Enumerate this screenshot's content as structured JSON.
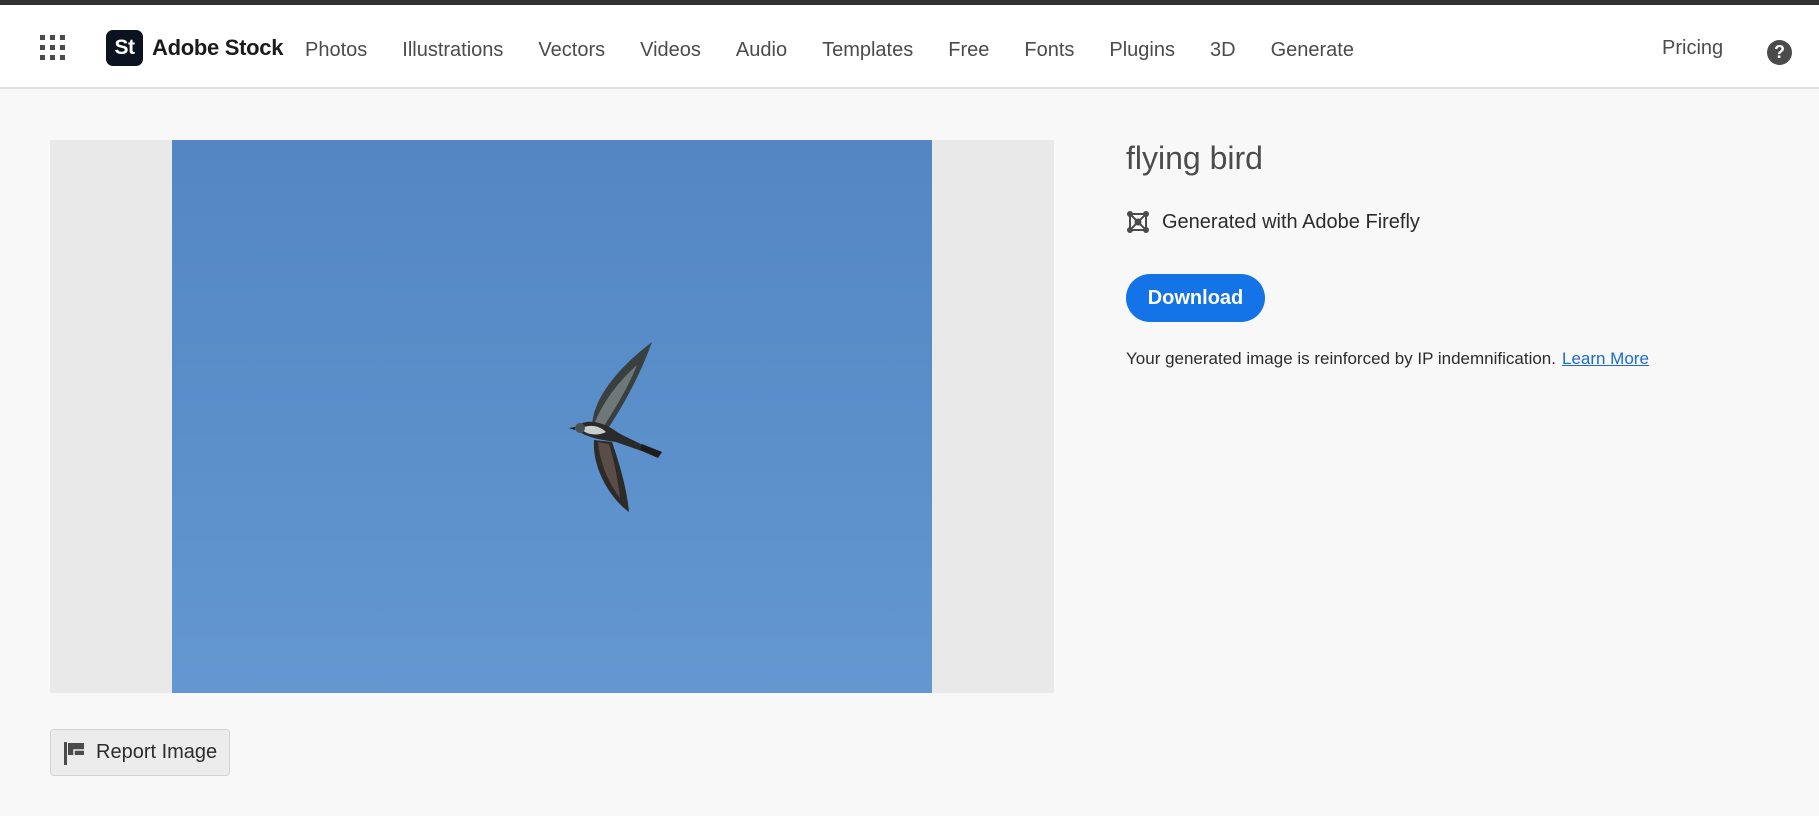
{
  "header": {
    "brand_logo": "St",
    "brand_name": "Adobe Stock",
    "nav": [
      {
        "label": "Photos"
      },
      {
        "label": "Illustrations"
      },
      {
        "label": "Vectors"
      },
      {
        "label": "Videos"
      },
      {
        "label": "Audio"
      },
      {
        "label": "Templates"
      },
      {
        "label": "Free"
      },
      {
        "label": "Fonts"
      },
      {
        "label": "Plugins"
      },
      {
        "label": "3D"
      },
      {
        "label": "Generate"
      }
    ],
    "pricing_label": "Pricing",
    "help_icon": "?"
  },
  "asset": {
    "title": "flying bird",
    "generated_with": "Generated with Adobe Firefly",
    "download_label": "Download",
    "ip_note": "Your generated image is reinforced by IP indemnification.",
    "learn_more_label": "Learn More"
  },
  "report": {
    "label": "Report Image"
  },
  "colors": {
    "accent": "#1473e6",
    "sky": "#5a8fca",
    "brand_logo_bg": "#0b1220"
  },
  "icons": {
    "app_switcher": "app-grid-icon",
    "firefly": "firefly-generated-icon",
    "report": "flag-icon",
    "help": "question-mark-icon"
  }
}
